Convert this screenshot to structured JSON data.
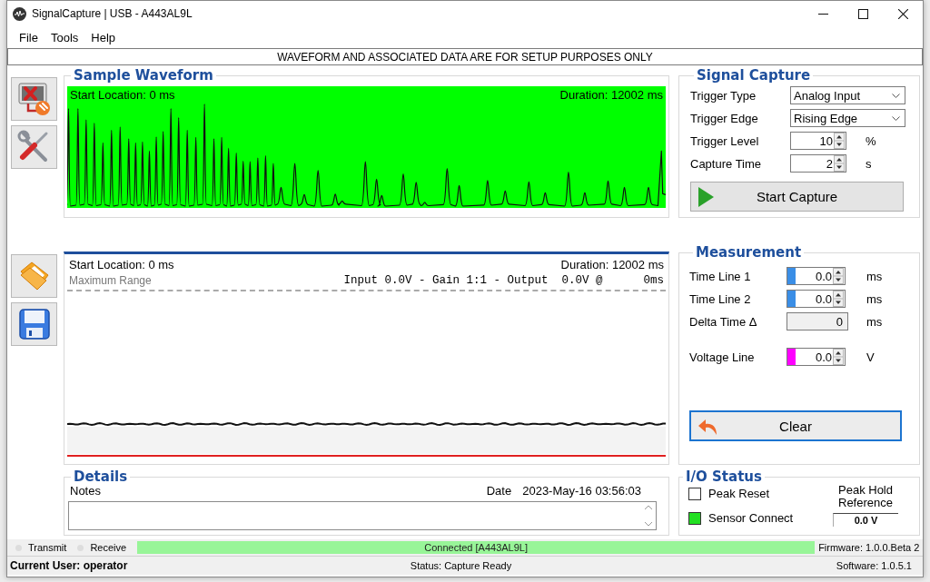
{
  "window": {
    "title": "SignalCapture | USB - A443AL9L"
  },
  "menu": [
    "File",
    "Tools",
    "Help"
  ],
  "banner": "WAVEFORM AND ASSOCIATED DATA ARE FOR SETUP PURPOSES ONLY",
  "sample_waveform": {
    "title": "Sample Waveform",
    "start_location": "Start Location: 0 ms",
    "duration": "Duration: 12002 ms"
  },
  "signal_capture": {
    "title": "Signal Capture",
    "fields": [
      {
        "kind": "dropdown",
        "label": "Trigger Type",
        "value": "Analog Input"
      },
      {
        "kind": "dropdown",
        "label": "Trigger Edge",
        "value": "Rising Edge"
      },
      {
        "kind": "spinner",
        "label": "Trigger Level",
        "value": "10",
        "unit": "%"
      },
      {
        "kind": "spinner",
        "label": "Capture Time",
        "value": "2",
        "unit": "s"
      }
    ],
    "button": "Start Capture"
  },
  "capture_view": {
    "start_location": "Start Location: 0 ms",
    "duration": "Duration: 12002 ms",
    "range_label": "Maximum Range",
    "readout": "Input 0.0V - Gain 1:1 - Output  0.0V @      0ms"
  },
  "measurement": {
    "title": "Measurement",
    "fields": [
      {
        "kind": "spinner",
        "label": "Time Line 1",
        "value": "0.0",
        "unit": "ms",
        "color": "#3a8ee6"
      },
      {
        "kind": "spinner",
        "label": "Time Line 2",
        "value": "0.0",
        "unit": "ms",
        "color": "#3a8ee6"
      },
      {
        "kind": "readonly",
        "label": "Delta Time Δ",
        "value": "0",
        "unit": "ms"
      },
      {
        "kind": "spinner",
        "label": "Voltage Line",
        "value": "0.0",
        "unit": "V",
        "color": "#ff00ff"
      }
    ],
    "button": "Clear"
  },
  "details": {
    "title": "Details",
    "notes_label": "Notes",
    "date_label": "Date",
    "date": "2023-May-16 03:56:03"
  },
  "io_status": {
    "title": "I/O Status",
    "items": [
      {
        "label": "Peak Reset",
        "checked": false
      },
      {
        "label": "Sensor Connect",
        "checked": true
      }
    ],
    "peak_hold_label": "Peak Hold Reference",
    "peak_hold_value": "0.0 V"
  },
  "status_bar": {
    "indicators": [
      {
        "label": "Transmit",
        "on": false
      },
      {
        "label": "Receive",
        "on": false
      }
    ],
    "connection": "Connected [A443AL9L]",
    "firmware": "Firmware: 1.0.0.Beta 2",
    "user": "Current User: operator",
    "status": "Status: Capture Ready",
    "software": "Software: 1.0.5.1"
  }
}
